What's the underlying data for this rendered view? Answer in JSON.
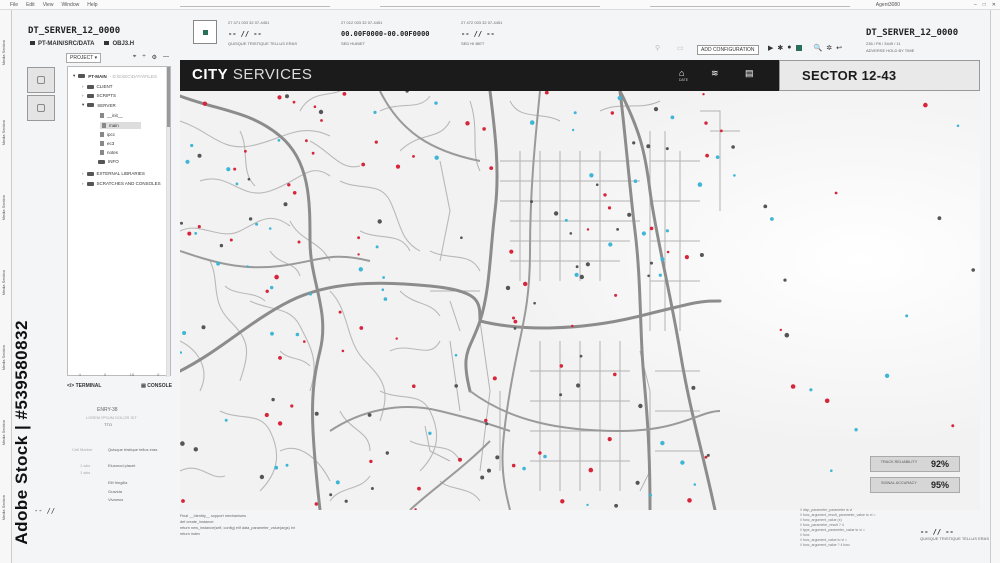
{
  "os": {
    "menu": [
      "File",
      "Edit",
      "View",
      "Window",
      "Help"
    ],
    "app_title": "Agent3080"
  },
  "left_strip_labels": [
    "Media Section",
    "Media Section",
    "Media Section",
    "Media Section",
    "Media Section",
    "Media Section",
    "Media Section"
  ],
  "watermark": "Adobe Stock | #539580832",
  "header_left": {
    "server_title": "DT_SERVER_12_0000",
    "path": "PT-MAIN/SRC/DATA",
    "file": "OBJ3.H"
  },
  "project_bar": {
    "label": "PROJECT",
    "tools": [
      "⌖",
      "÷",
      "⚙",
      "—"
    ]
  },
  "tree": {
    "root": "PT-MAIN",
    "root_dim": "- D:\\EXEC\\DATA\\FILES",
    "items": [
      {
        "label": "CLIENT",
        "type": "folder"
      },
      {
        "label": "SCRIPTS",
        "type": "folder"
      },
      {
        "label": "SERVER",
        "type": "folder"
      },
      {
        "label": "__init__",
        "type": "file"
      },
      {
        "label": "main",
        "type": "file"
      },
      {
        "label": "ipcc",
        "type": "file"
      },
      {
        "label": "ec3",
        "type": "file"
      },
      {
        "label": "notes",
        "type": "file"
      },
      {
        "label": "INFO",
        "type": "folder"
      },
      {
        "label": "EXTERNAL LIBRARIES",
        "type": "folder"
      },
      {
        "label": "SCRATCHES AND CONSOLES",
        "type": "folder"
      }
    ],
    "footer": [
      "4",
      "0",
      "18",
      "0"
    ]
  },
  "terminal": {
    "terminal_label": "TERMINAL",
    "console_label": "CONSOLE"
  },
  "top_blocks": [
    {
      "codes": "27  471  003      32  07-4451",
      "value": "-- // --",
      "caption": "QUISQUE TRISTIQUE TELLUS ERAS"
    },
    {
      "codes": "27  012  003      32  07-4451",
      "value": "00.00F0000-00.00F0000",
      "caption": "SED HUBIET"
    },
    {
      "codes": "27  472  003      32  07-4451",
      "value": "-- // --",
      "caption": "SED HI BIET"
    }
  ],
  "toolbar": {
    "add_config": "ADD CONFIGURATION",
    "icons": [
      "▶",
      "⏸",
      "⏵",
      "🔍",
      "✲",
      "↩"
    ]
  },
  "header_right": {
    "server_title": "DT_SERVER_12_0000",
    "sub": "236 / P8 / 3449 / 11",
    "sub2": "ADVERSE HOLD BY TIME"
  },
  "city": {
    "title_bold": "CITY",
    "title_light": "SERVICES",
    "icons": [
      {
        "name": "home-icon",
        "glyph": "⌂",
        "caption": "DATE"
      },
      {
        "name": "wifi-icon",
        "glyph": "≋",
        "caption": ""
      },
      {
        "name": "chat-icon",
        "glyph": "▤",
        "caption": ""
      }
    ],
    "sector": "SECTOR 12-43"
  },
  "stats": [
    {
      "label": "TRACK RELIABILITY",
      "value": "92%"
    },
    {
      "label": "SIGNAL ACCURACY",
      "value": "95%"
    }
  ],
  "left_ghost": {
    "code": "ENRY-38",
    "subtitle": "LOREM IPSUM DOLOR SIT",
    "num": "TTO",
    "rows": [
      [
        "Cell Marker",
        "Quisque tristique tellus eras"
      ],
      [
        "1 wks",
        "Eiusmod placet"
      ],
      [
        "1 wks",
        ""
      ],
      [
        "",
        "Elit fringilla"
      ],
      [
        "",
        "Gravida"
      ],
      [
        "",
        "Vivamus"
      ]
    ]
  },
  "bottom_log": [
    "Final __Identity__ support mechanisms",
    "",
    "def create_instance:",
    "  return new_instance(self, config) elif data_parameter_value(args) int",
    "  return index"
  ],
  "bottom_right_log": [
    "// disp_parameter_parameter is vi",
    "  // func_argument_result_parameter_value to vi =",
    "  // func_argument_value (x)",
    "  // func_parameter_result ? 4",
    "  // type_argument_parameter_value to vi =",
    "  // func",
    "  // func_argument_value to vi =",
    "  // func_argument_value ? 4 func"
  ],
  "bottom_right": {
    "value": "-- // --",
    "caption": "QUISQUE TRISTIQUE TELLUS ERAS"
  },
  "left_bottom_marker": "-- //"
}
